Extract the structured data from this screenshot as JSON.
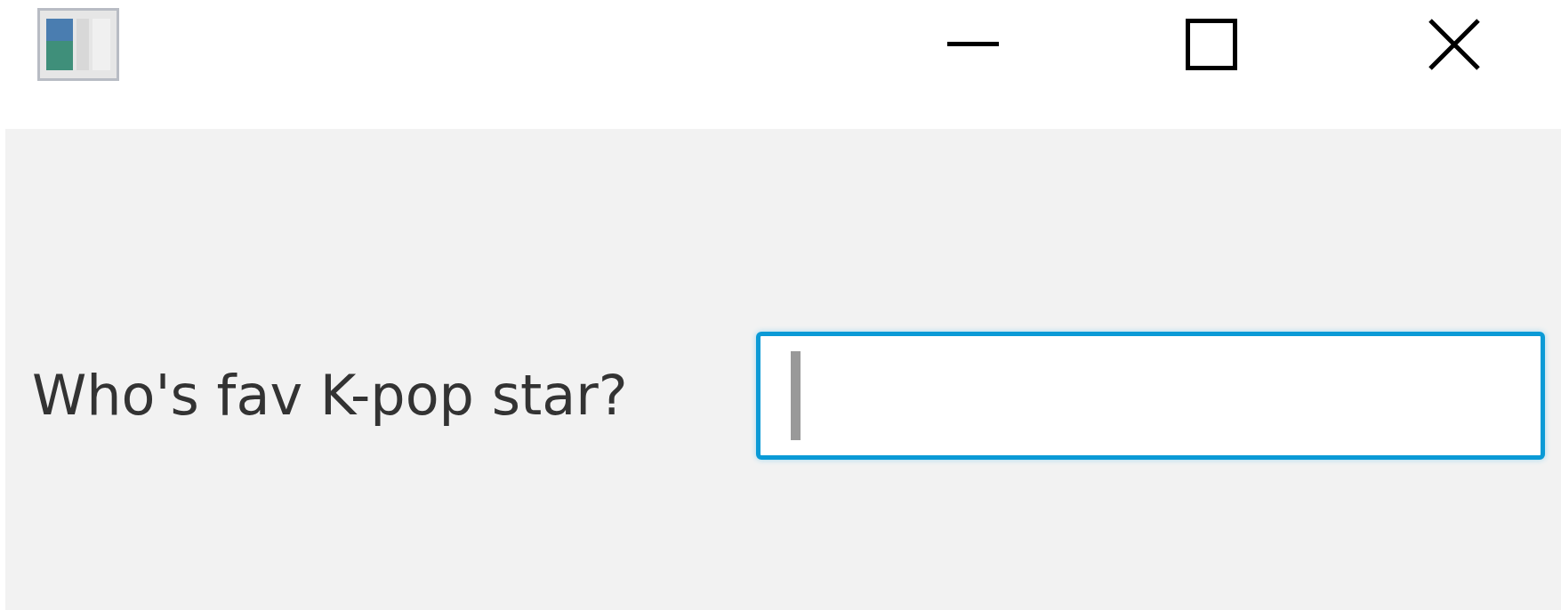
{
  "prompt": {
    "label": "Who's fav K-pop star?"
  },
  "answer_field": {
    "focused": true
  }
}
